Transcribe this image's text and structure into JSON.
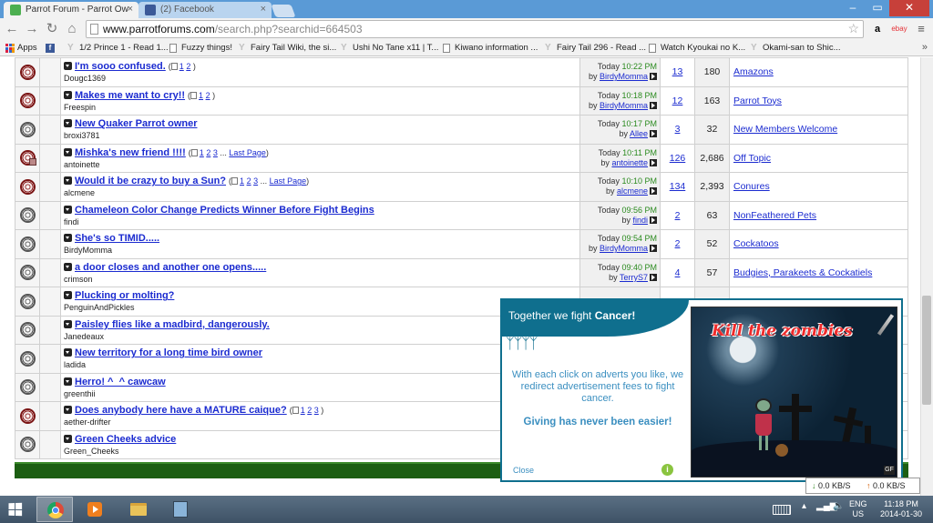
{
  "browser": {
    "tabs": [
      {
        "label": "Parrot Forum - Parrot Ow",
        "active": true,
        "favicon_color": "#4caf50"
      },
      {
        "label": "(2) Facebook",
        "active": false,
        "favicon_color": "#3b5998"
      }
    ],
    "window_controls": {
      "minimize": "–",
      "maximize": "▭",
      "close": "✕"
    },
    "url": {
      "host": "www.parrotforums.com",
      "path": "/search.php?searchid=664503"
    },
    "extensions": {
      "amazon": "a",
      "ebay": "ebay"
    }
  },
  "bookmarks": [
    {
      "label": "Apps",
      "icon": "apps-icon"
    },
    {
      "label": "f",
      "icon": "facebook-icon"
    },
    {
      "label": "1/2 Prince 1 - Read 1...",
      "icon": "ycombinator-icon"
    },
    {
      "label": "Fuzzy things!",
      "icon": "page-icon"
    },
    {
      "label": "Fairy Tail Wiki, the si...",
      "icon": "ycombinator-icon"
    },
    {
      "label": "Ushi No Tane x11 | T...",
      "icon": "ycombinator-icon"
    },
    {
      "label": "Kiwano information ...",
      "icon": "page-icon"
    },
    {
      "label": "Fairy Tail 296 - Read ...",
      "icon": "ycombinator-icon"
    },
    {
      "label": "Watch Kyoukai no K...",
      "icon": "page-icon"
    },
    {
      "label": "Okami-san to Shic...",
      "icon": "ycombinator-icon"
    }
  ],
  "threads": [
    {
      "icon": "red",
      "title": "I'm sooo confused.",
      "pages": [
        "1",
        "2"
      ],
      "last_page": "",
      "author": "Dougc1369",
      "today": "Today",
      "time": "10:22 PM",
      "by": "by",
      "last_poster": "BirdyMomma",
      "replies": "13",
      "views": "180",
      "forum": "Amazons"
    },
    {
      "icon": "red",
      "title": "Makes me want to cry!!",
      "pages": [
        "1",
        "2"
      ],
      "last_page": "",
      "author": "Freespin",
      "today": "Today",
      "time": "10:18 PM",
      "by": "by",
      "last_poster": "BirdyMomma",
      "replies": "12",
      "views": "163",
      "forum": "Parrot Toys"
    },
    {
      "icon": "gray",
      "title": "New Quaker Parrot owner",
      "pages": [],
      "last_page": "",
      "author": "broxi3781",
      "today": "Today",
      "time": "10:17 PM",
      "by": "by",
      "last_poster": "Allee",
      "replies": "3",
      "views": "32",
      "forum": "New Members Welcome"
    },
    {
      "icon": "red-lock",
      "title": "Mishka's new friend !!!!",
      "pages": [
        "1",
        "2",
        "3"
      ],
      "last_page": "Last Page",
      "author": "antoinette",
      "today": "Today",
      "time": "10:11 PM",
      "by": "by",
      "last_poster": "antoinette",
      "replies": "126",
      "views": "2,686",
      "forum": "Off Topic"
    },
    {
      "icon": "red",
      "title": "Would it be crazy to buy a Sun?",
      "pages": [
        "1",
        "2",
        "3"
      ],
      "last_page": "Last Page",
      "author": "alcmene",
      "today": "Today",
      "time": "10:10 PM",
      "by": "by",
      "last_poster": "alcmene",
      "replies": "134",
      "views": "2,393",
      "forum": "Conures"
    },
    {
      "icon": "gray",
      "title": "Chameleon Color Change Predicts Winner Before Fight Begins",
      "pages": [],
      "last_page": "",
      "author": "findi",
      "today": "Today",
      "time": "09:56 PM",
      "by": "by",
      "last_poster": "findi",
      "replies": "2",
      "views": "63",
      "forum": "NonFeathered Pets"
    },
    {
      "icon": "gray",
      "title": "She's so TIMID.....",
      "pages": [],
      "last_page": "",
      "author": "BirdyMomma",
      "today": "Today",
      "time": "09:54 PM",
      "by": "by",
      "last_poster": "BirdyMomma",
      "replies": "2",
      "views": "52",
      "forum": "Cockatoos"
    },
    {
      "icon": "gray",
      "title": "a door closes and another one opens.....",
      "pages": [],
      "last_page": "",
      "author": "crimson",
      "today": "Today",
      "time": "09:40 PM",
      "by": "by",
      "last_poster": "TerryS7",
      "replies": "4",
      "views": "57",
      "forum": "Budgies, Parakeets & Cockatiels"
    },
    {
      "icon": "gray",
      "title": "Plucking or molting?",
      "pages": [],
      "last_page": "",
      "author": "PenguinAndPickles",
      "today": "",
      "time": "",
      "by": "",
      "last_poster": "",
      "replies": "",
      "views": "",
      "forum": ""
    },
    {
      "icon": "gray",
      "title": "Paisley flies like a madbird, dangerously.",
      "pages": [],
      "last_page": "",
      "author": "Janedeaux",
      "today": "",
      "time": "",
      "by": "",
      "last_poster": "",
      "replies": "",
      "views": "",
      "forum": ""
    },
    {
      "icon": "gray",
      "title": "New territory for a long time bird owner",
      "pages": [],
      "last_page": "",
      "author": "ladida",
      "today": "",
      "time": "",
      "by": "",
      "last_poster": "",
      "replies": "",
      "views": "",
      "forum": ""
    },
    {
      "icon": "gray",
      "title": "Herro! ^_^ cawcaw",
      "pages": [],
      "last_page": "",
      "author": "greenthii",
      "today": "",
      "time": "",
      "by": "",
      "last_poster": "",
      "replies": "",
      "views": "",
      "forum": ""
    },
    {
      "icon": "red",
      "title": "Does anybody here have a MATURE caique?",
      "pages": [
        "1",
        "2",
        "3"
      ],
      "last_page": "",
      "author": "aether-drifter",
      "today": "",
      "time": "",
      "by": "",
      "last_poster": "",
      "replies": "",
      "views": "",
      "forum": ""
    },
    {
      "icon": "gray",
      "title": "Green Cheeks advice",
      "pages": [],
      "last_page": "",
      "author": "Green_Cheeks",
      "today": "",
      "time": "",
      "by": "",
      "last_poster": "",
      "replies": "",
      "views": "",
      "forum": ""
    }
  ],
  "ad": {
    "banner_prefix": "Together we fight",
    "banner_bold": "Cancer!",
    "message": "With each click on adverts you like, we redirect advertisement fees to fight cancer.",
    "giving": "Giving has never been easier!",
    "close": "Close",
    "info": "i",
    "image_title": "Kill the zombies",
    "corner": "GF"
  },
  "netmeter": {
    "down": "0.0 KB/S",
    "up": "0.0 KB/S"
  },
  "taskbar": {
    "lang_top": "ENG",
    "lang_bottom": "US",
    "time": "11:18 PM",
    "date": "2014-01-30"
  }
}
